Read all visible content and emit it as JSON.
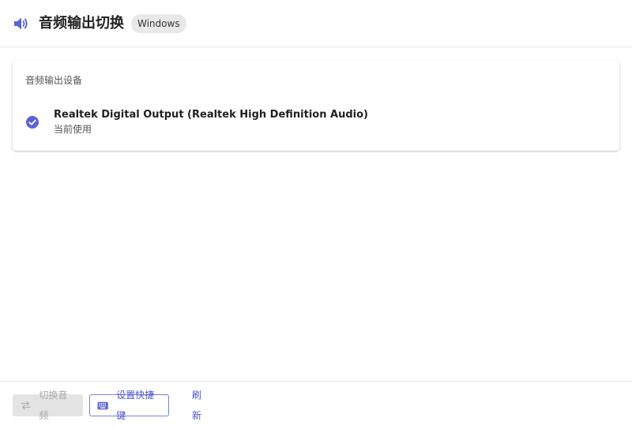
{
  "header": {
    "title": "音频输出切换",
    "platform_badge": "Windows",
    "icon": "speaker-icon"
  },
  "output_section": {
    "title": "音频输出设备",
    "devices": [
      {
        "name": "Realtek Digital Output (Realtek High Definition Audio)",
        "status": "当前使用",
        "selected": true,
        "icon": "check-circle-icon"
      }
    ]
  },
  "footer": {
    "switch_label": "切换音频",
    "switch_icon": "swap-arrows-icon",
    "switch_disabled": true,
    "shortcut_label": "设置快捷键",
    "shortcut_icon": "keyboard-icon",
    "refresh_label": "刷新"
  },
  "colors": {
    "accent": "#5b62d6",
    "accent_text": "#4b54c8",
    "disabled_bg": "#e4e4e4",
    "disabled_text": "#a9a9a9",
    "divider": "#e6e6e6"
  }
}
